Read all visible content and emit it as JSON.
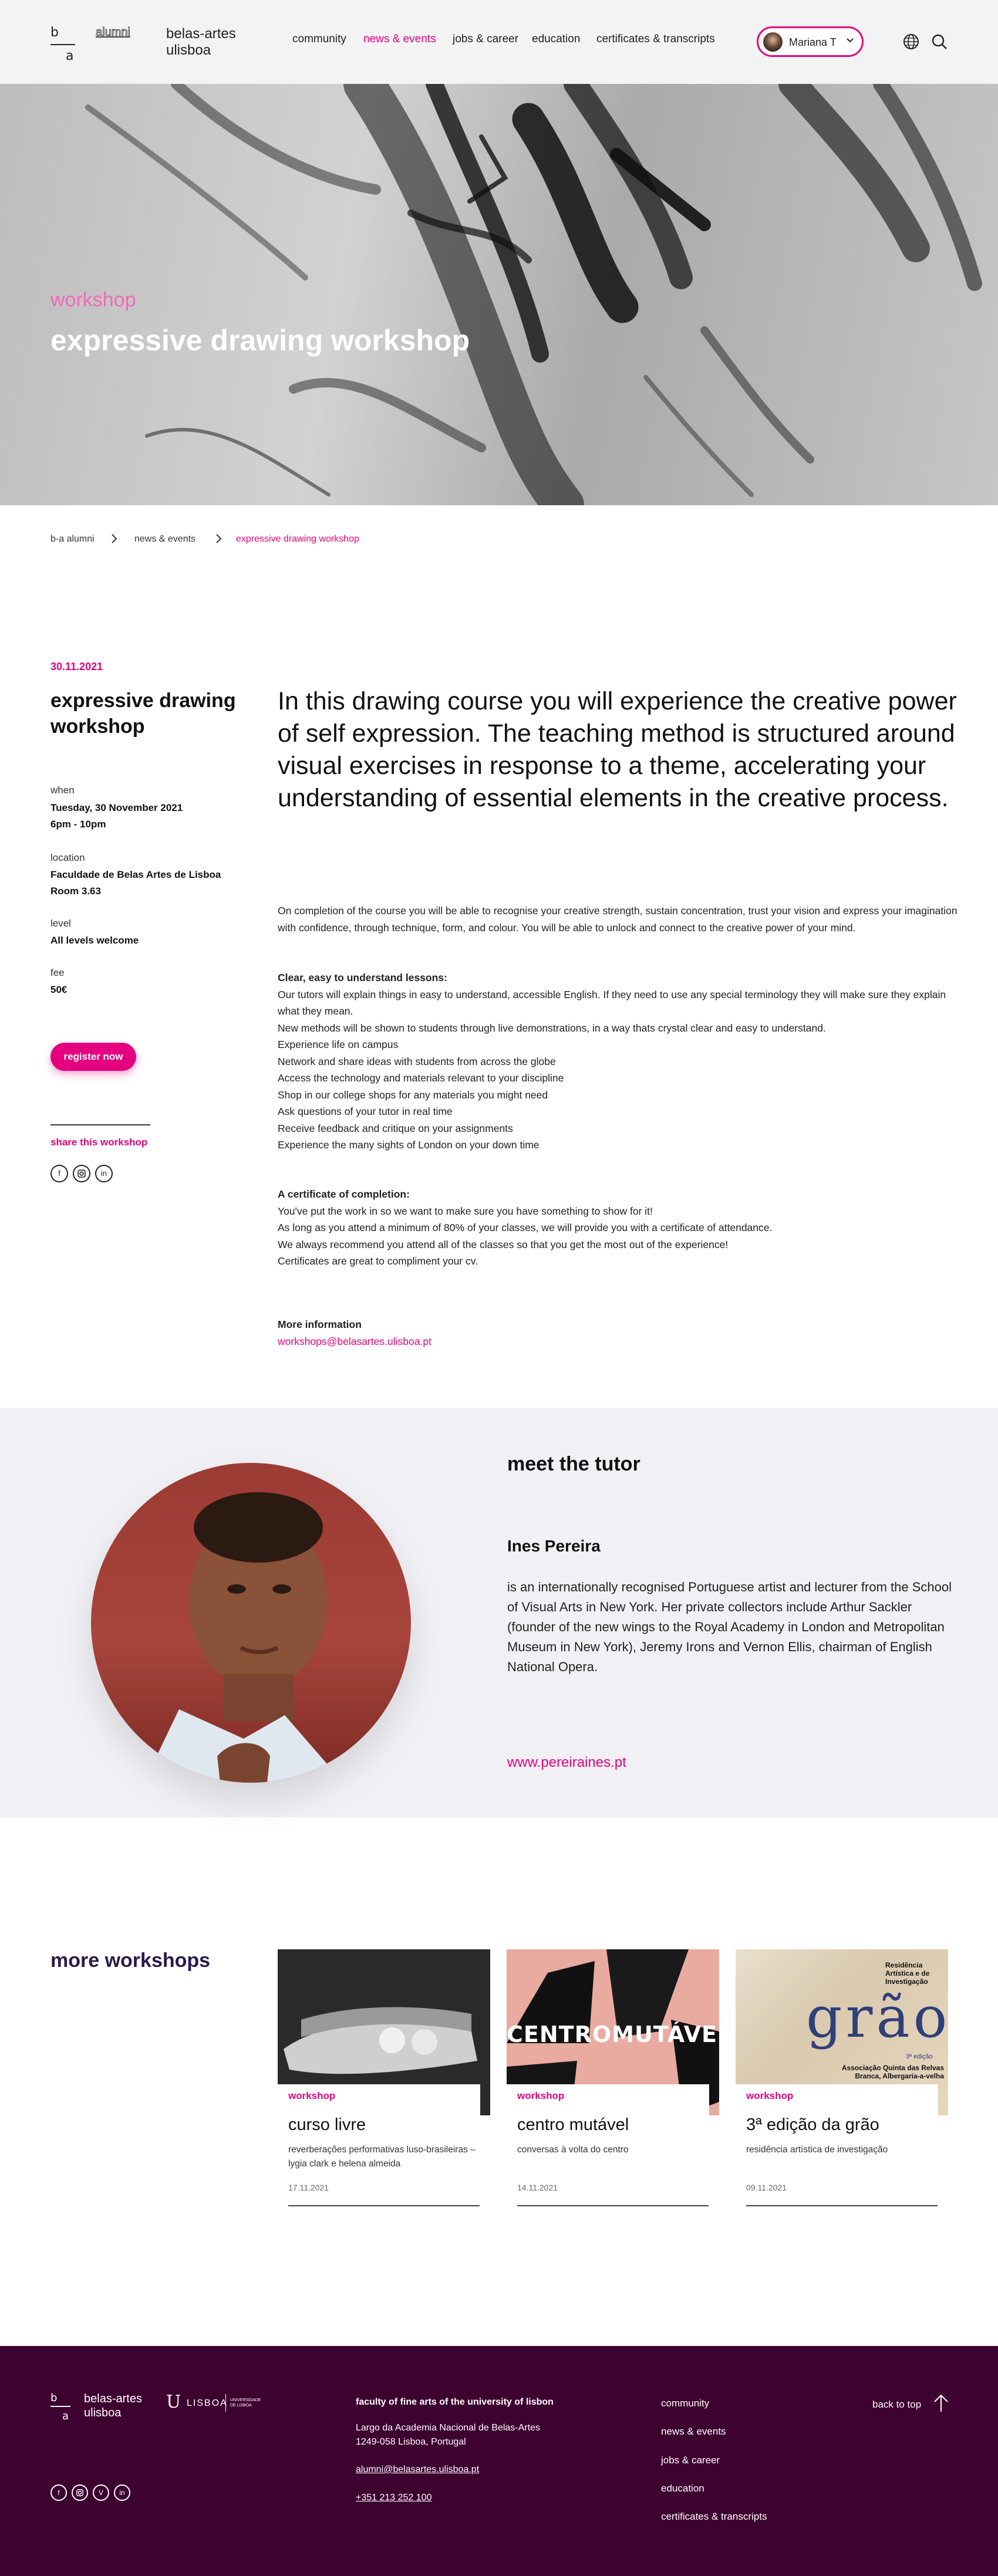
{
  "header": {
    "logo_top": "b",
    "logo_bottom": "a",
    "alumni_label": "alumni",
    "brand_line1": "belas-artes",
    "brand_line2": "ulisboa",
    "nav": [
      "community",
      "news & events",
      "jobs & career",
      "education",
      "certificates & transcripts"
    ],
    "active_nav": "news & events",
    "user_name": "Mariana T",
    "accent": "#e4007f"
  },
  "hero": {
    "tag": "workshop",
    "title": "expressive drawing workshop"
  },
  "breadcrumb": [
    "b-a alumni",
    "news & events",
    "expressive drawing workshop"
  ],
  "event": {
    "date": "30.11.2021",
    "title": "expressive drawing workshop",
    "when_label": "when",
    "when_value1": "Tuesday, 30 November 2021",
    "when_value2": "6pm - 10pm",
    "location_label": "location",
    "location_value1": "Faculdade de Belas Artes de Lisboa",
    "location_value2": "Room 3.63",
    "level_label": "level",
    "level_value": "All levels welcome",
    "fee_label": "fee",
    "fee_value": "50€",
    "register_label": "register now",
    "share_label": "share this workshop"
  },
  "content": {
    "lead": "In this drawing course you will experience the creative power of self expression. The teaching method is structured around visual exercises in response to a theme, accelerating your understanding of essential elements in the creative process.",
    "intro": "On completion of the course you will be able to recognise your creative strength, sustain concentration, trust your vision and express your imagination with confidence, through technique, form, and colour. You will be able to unlock and connect to the creative power of your mind.",
    "lessons_heading": "Clear, easy to understand lessons:",
    "lessons": [
      "Our tutors will explain things in easy to understand, accessible English. If they need to use any special terminology they will make sure they explain what they mean.",
      "New methods will be shown to students through live demonstrations, in a way thats crystal clear and easy to understand.",
      "Experience life on campus",
      "Network and share ideas with students from across the globe",
      "Access the technology and materials relevant to your discipline",
      "Shop in our college shops for any materials you might need",
      "Ask questions of your tutor in real time",
      "Receive feedback and critique on your assignments",
      "Experience the many sights of London on your down time"
    ],
    "certificate_heading": "A certificate of completion:",
    "certificate": [
      "You've put the work in so we want to make sure you have something to show for it!",
      "As long as you attend a minimum of 80% of your classes, we will provide you with a certificate of attendance.",
      "We always recommend you attend all of the classes so that you get the most out of the experience!",
      "Certificates are great to compliment your cv."
    ],
    "more_info_label": "More information",
    "more_info_email": "workshops@belasartes.ulisboa.pt"
  },
  "tutor": {
    "heading": "meet the tutor",
    "name": "Ines Pereira",
    "bio": "is an internationally recognised Portuguese artist and lecturer from the School of Visual Arts in New York. Her private collectors include Arthur Sackler (founder of the new wings to the Royal Academy in London and Metropolitan Museum in New York), Jeremy Irons and Vernon Ellis, chairman of English National Opera.",
    "website": "www.pereiraines.pt"
  },
  "more_workshops": {
    "heading": "more workshops",
    "cards": [
      {
        "tag": "workshop",
        "title": "curso livre",
        "subtitle": "reverberações performativas luso-brasileiras – lygia clark e helena almeida",
        "date": "17.11.2021"
      },
      {
        "tag": "workshop",
        "title": "centro mutável",
        "subtitle": "conversas à volta do centro",
        "date": "14.11.2021",
        "image_text": "CENTROMUTÁVEL"
      },
      {
        "tag": "workshop",
        "title": "3ª edição da grão",
        "subtitle": "residência artística de investigação",
        "date": "09.11.2021",
        "image_text_top": "Residência Artística e de Investigação",
        "image_word": "grão",
        "image_edition": "3ª edição",
        "image_text_bottom": "Associação Quinta das Relvas Branca, Albergaria-a-velha"
      }
    ]
  },
  "footer": {
    "brand_line1": "belas-artes",
    "brand_line2": "ulisboa",
    "university_label": "LISBOA",
    "university_sub": "UNIVERSIDADE DE LISBOA",
    "faculty": "faculty of fine arts of the university of lisbon",
    "address1": "Largo da Academia Nacional de Belas-Artes",
    "address2": "1249-058 Lisboa, Portugal",
    "email": "alumni@belasartes.ulisboa.pt",
    "phone": "+351 213 252 100",
    "links": [
      "community",
      "news & events",
      "jobs & career",
      "education",
      "certificates & transcripts"
    ],
    "back_to_top": "back to top",
    "bg_color": "#3e0230"
  },
  "icons": [
    "globe-icon",
    "search-icon",
    "chevron-down-icon",
    "chevron-right-icon",
    "facebook-icon",
    "instagram-icon",
    "linkedin-icon",
    "vimeo-icon",
    "arrow-up-icon"
  ]
}
